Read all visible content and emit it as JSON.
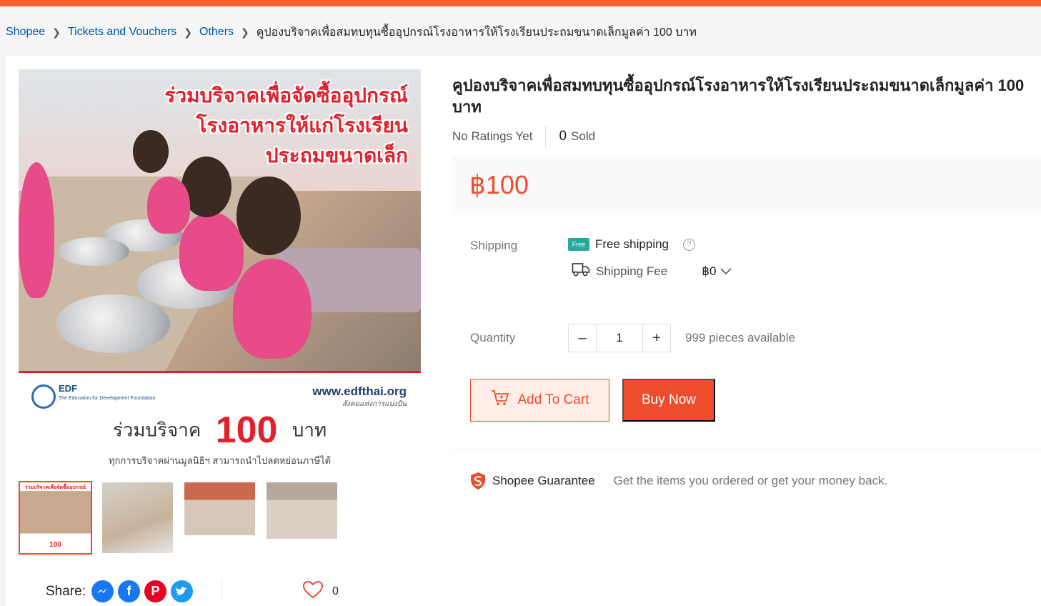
{
  "breadcrumb": {
    "items": [
      "Shopee",
      "Tickets and Vouchers",
      "Others"
    ],
    "current": "คูปองบริจาคเพื่อสมทบทุนซื้ออุปกรณ์โรงอาหารให้โรงเรียนประถมขนาดเล็กมูลค่า 100 บาท"
  },
  "gallery": {
    "headline": [
      "ร่วมบริจาคเพื่อจัดซื้ออุปกรณ์",
      "โรงอาหารให้แก่โรงเรียน",
      "ประถมขนาดเล็ก"
    ],
    "org_short": "EDF",
    "org_name": "The Education for Development Foundation",
    "url": "www.edfthai.org",
    "tagline": "สังคมแห่งการแบ่งปัน",
    "donate_prefix": "ร่วมบริจาค",
    "donate_amount": "100",
    "donate_suffix": "บาท",
    "note": "ทุกการบริจาคผ่านมูลนิธิฯ สามารถนำไปลดหย่อนภาษีได้",
    "thumbnails": [
      {
        "active": true
      },
      {
        "active": false
      },
      {
        "active": false
      },
      {
        "active": false
      }
    ]
  },
  "share": {
    "label": "Share:",
    "networks": [
      "messenger-icon",
      "facebook-icon",
      "pinterest-icon",
      "twitter-icon"
    ],
    "likes": "0"
  },
  "product": {
    "title": "คูปองบริจาคเพื่อสมทบทุนซื้ออุปกรณ์โรงอาหารให้โรงเรียนประถมขนาดเล็กมูลค่า 100 บาท",
    "ratings": "No Ratings Yet",
    "sold_count": "0",
    "sold_label": "Sold",
    "price": "฿100"
  },
  "shipping": {
    "label": "Shipping",
    "free_badge": "Free",
    "free_text": "Free shipping",
    "fee_label": "Shipping Fee",
    "fee_value": "฿0"
  },
  "quantity": {
    "label": "Quantity",
    "value": "1",
    "stock": "999 pieces available"
  },
  "actions": {
    "add_to_cart": "Add To Cart",
    "buy_now": "Buy Now"
  },
  "guarantee": {
    "title": "Shopee Guarantee",
    "text": "Get the items you ordered or get your money back."
  },
  "colors": {
    "brand": "#ee4d2d",
    "topbar": "#f6602d",
    "link": "#0055aa",
    "free_badge": "#26aa99"
  }
}
